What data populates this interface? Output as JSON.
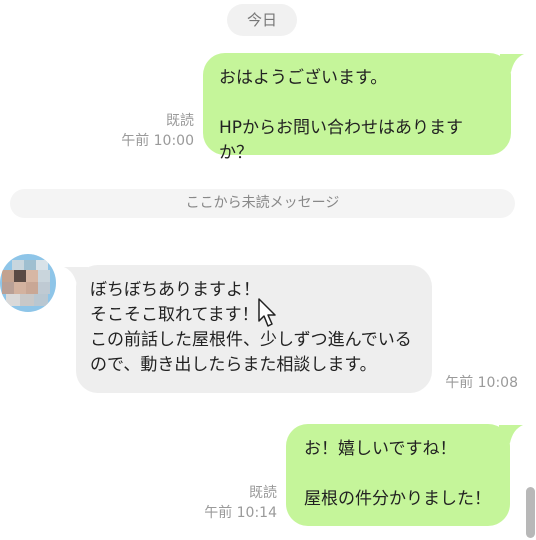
{
  "date_separator": "今日",
  "unread_divider": "ここから未読メッセージ",
  "messages": [
    {
      "direction": "outgoing",
      "text": "おはようございます。\n\nHPからお問い合わせはありますか？",
      "read_status": "既読",
      "time": "午前 10:00"
    },
    {
      "direction": "incoming",
      "text": "ぼちぼちありますよ！\nそこそこ取れてます！\nこの前話した屋根件、少しずつ進んでいるので、動き出したらまた相談します。",
      "time": "午前 10:08"
    },
    {
      "direction": "outgoing",
      "text": "お！嬉しいですね！\n\n屋根の件分かりました！",
      "read_status": "既読",
      "time": "午前 10:14"
    }
  ],
  "icons": {
    "avatar": "pixelated-avatar",
    "cursor": "mouse-pointer-icon"
  },
  "colors": {
    "outgoing_bubble": "#c5f59a",
    "incoming_bubble": "#eeeeee",
    "meta_text": "#9a9a9a"
  }
}
